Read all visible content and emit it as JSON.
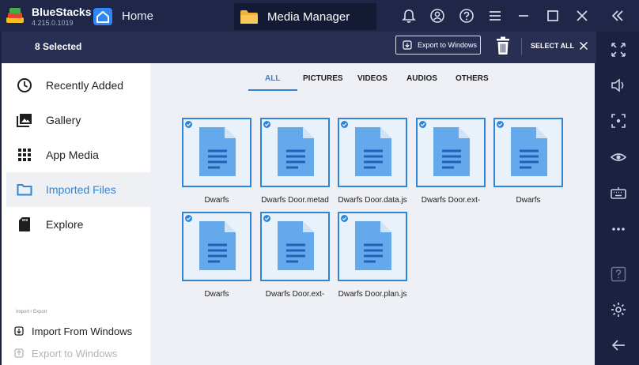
{
  "app": {
    "name": "BlueStacks",
    "version": "4.215.0.1019"
  },
  "tabs": {
    "home": "Home",
    "media": "Media Manager"
  },
  "selection": {
    "count_label": "8 Selected",
    "export_label": "Export to Windows",
    "select_all_label": "SELECT ALL"
  },
  "sidebar": {
    "items": [
      {
        "label": "Recently Added",
        "icon": "clock-icon"
      },
      {
        "label": "Gallery",
        "icon": "gallery-icon"
      },
      {
        "label": "App Media",
        "icon": "grid-icon"
      },
      {
        "label": "Imported Files",
        "icon": "folder-icon",
        "active": true
      },
      {
        "label": "Explore",
        "icon": "sd-card-icon"
      }
    ],
    "import_export_header": "Import / Export",
    "import_label": "Import From Windows",
    "export_label": "Export to Windows"
  },
  "filters": [
    "ALL",
    "PICTURES",
    "VIDEOS",
    "AUDIOS",
    "OTHERS"
  ],
  "active_filter": "ALL",
  "files": [
    {
      "name": "Dwarfs"
    },
    {
      "name": "Dwarfs Door.metad"
    },
    {
      "name": "Dwarfs Door.data.js"
    },
    {
      "name": "Dwarfs Door.ext-"
    },
    {
      "name": "Dwarfs"
    },
    {
      "name": "Dwarfs"
    },
    {
      "name": "Dwarfs Door.ext-"
    },
    {
      "name": "Dwarfs Door.plan.js"
    }
  ],
  "colors": {
    "accent": "#2f86d8",
    "titlebar": "#1f2648",
    "selbar": "#282f52",
    "sidebar": "#1b2140"
  }
}
